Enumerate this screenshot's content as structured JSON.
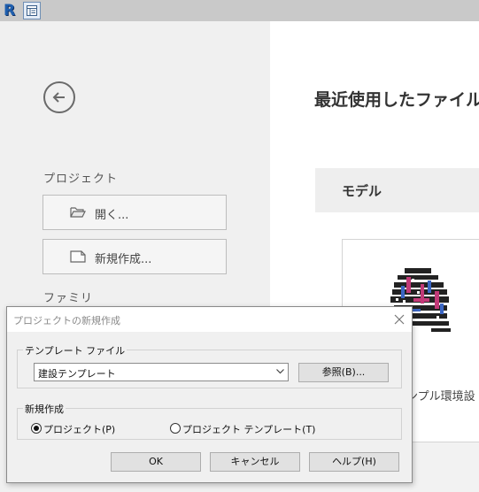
{
  "app": {
    "logo_letter": "R"
  },
  "left": {
    "project_label": "プロジェクト",
    "open_label": "開く...",
    "new_label": "新規作成...",
    "family_label": "ファミリ"
  },
  "right": {
    "recent_title": "最近使用したファイル",
    "model_label": "モデル",
    "thumb_caption": "ンプル環境設"
  },
  "dialog": {
    "title": "プロジェクトの新規作成",
    "template_group_label": "テンプレート ファイル",
    "template_value": "建設テンプレート",
    "browse_label": "参照(B)...",
    "create_group_label": "新規作成",
    "radio_project_label": "プロジェクト(P)",
    "radio_template_label": "プロジェクト テンプレート(T)",
    "radio_selected": "project",
    "ok_label": "OK",
    "cancel_label": "キャンセル",
    "help_label": "ヘルプ(H)"
  },
  "icons": {
    "back": "back-arrow-circle-icon",
    "open": "folder-open-icon",
    "new": "new-file-icon",
    "close": "close-icon",
    "dropdown": "chevron-down-icon",
    "toolbar": "properties-panel-icon"
  },
  "colors": {
    "accent": "#1f5fae"
  }
}
